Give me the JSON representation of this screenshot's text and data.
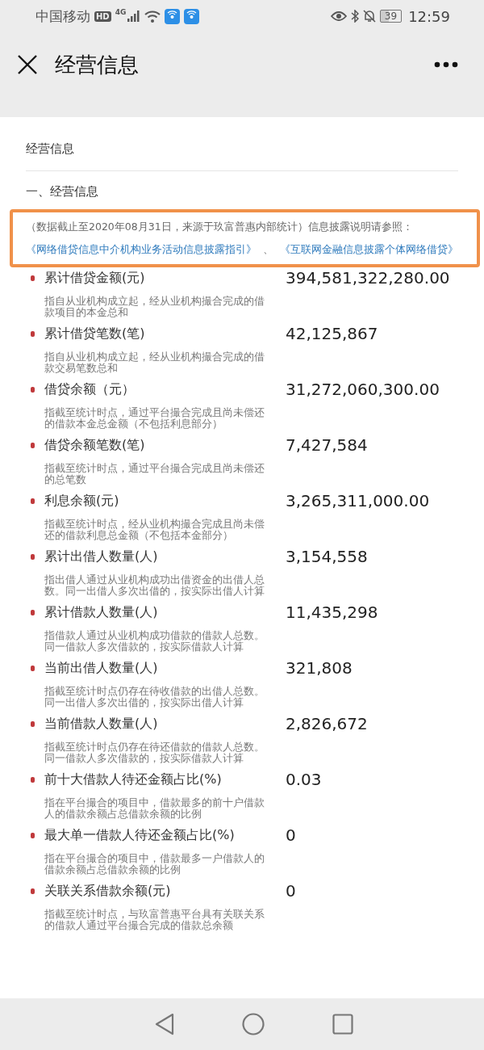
{
  "status_bar": {
    "carrier": "中国移动",
    "hd": "HD",
    "network": "4G",
    "battery": "39",
    "time": "12:59"
  },
  "header": {
    "title": "经营信息"
  },
  "card": {
    "title": "经营信息",
    "section": "一、经营信息",
    "notice": {
      "highlighted": true,
      "text": "（数据截止至2020年08月31日，来源于玖富普惠内部统计）信息披露说明请参照：",
      "links": [
        "《网络借贷信息中介机构业务活动信息披露指引》",
        "《互联网金融信息披露个体网络借贷》"
      ],
      "separator": "、"
    },
    "items": [
      {
        "label": "累计借贷金额(元)",
        "value": "394,581,322,280.00",
        "description": "指自从业机构成立起，经从业机构撮合完成的借款项目的本金总和"
      },
      {
        "label": "累计借贷笔数(笔)",
        "value": "42,125,867",
        "description": "指自从业机构成立起，经从业机构撮合完成的借款交易笔数总和"
      },
      {
        "label": "借贷余额（元）",
        "value": "31,272,060,300.00",
        "description": "指截至统计时点，通过平台撮合完成且尚未偿还的借款本金总金额（不包括利息部分）"
      },
      {
        "label": "借贷余额笔数(笔)",
        "value": "7,427,584",
        "description": "指截至统计时点，通过平台撮合完成且尚未偿还的总笔数"
      },
      {
        "label": "利息余额(元)",
        "value": "3,265,311,000.00",
        "description": "指截至统计时点，经从业机构撮合完成且尚未偿还的借款利息总金额（不包括本金部分）"
      },
      {
        "label": "累计出借人数量(人)",
        "value": "3,154,558",
        "description": "指出借人通过从业机构成功出借资金的出借人总数。同一出借人多次出借的，按实际出借人计算"
      },
      {
        "label": "累计借款人数量(人)",
        "value": "11,435,298",
        "description": "指借款人通过从业机构成功借款的借款人总数。同一借款人多次借款的，按实际借款人计算"
      },
      {
        "label": "当前出借人数量(人)",
        "value": "321,808",
        "description": "指截至统计时点仍存在待收借款的出借人总数。同一出借人多次出借的，按实际出借人计算"
      },
      {
        "label": "当前借款人数量(人)",
        "value": "2,826,672",
        "description": "指截至统计时点仍存在待还借款的借款人总数。同一借款人多次借款的，按实际借款人计算"
      },
      {
        "label": "前十大借款人待还金额占比(%)",
        "value": "0.03",
        "description": "指在平台撮合的项目中，借款最多的前十户借款人的借款余额占总借款余额的比例"
      },
      {
        "label": "最大单一借款人待还金额占比(%)",
        "value": "0",
        "description": "指在平台撮合的项目中，借款最多一户借款人的借款余额占总借款余额的比例"
      },
      {
        "label": "关联关系借款余额(元)",
        "value": "0",
        "description": "指截至统计时点，与玖富普惠平台具有关联关系的借款人通过平台撮合完成的借款总余额"
      }
    ]
  }
}
